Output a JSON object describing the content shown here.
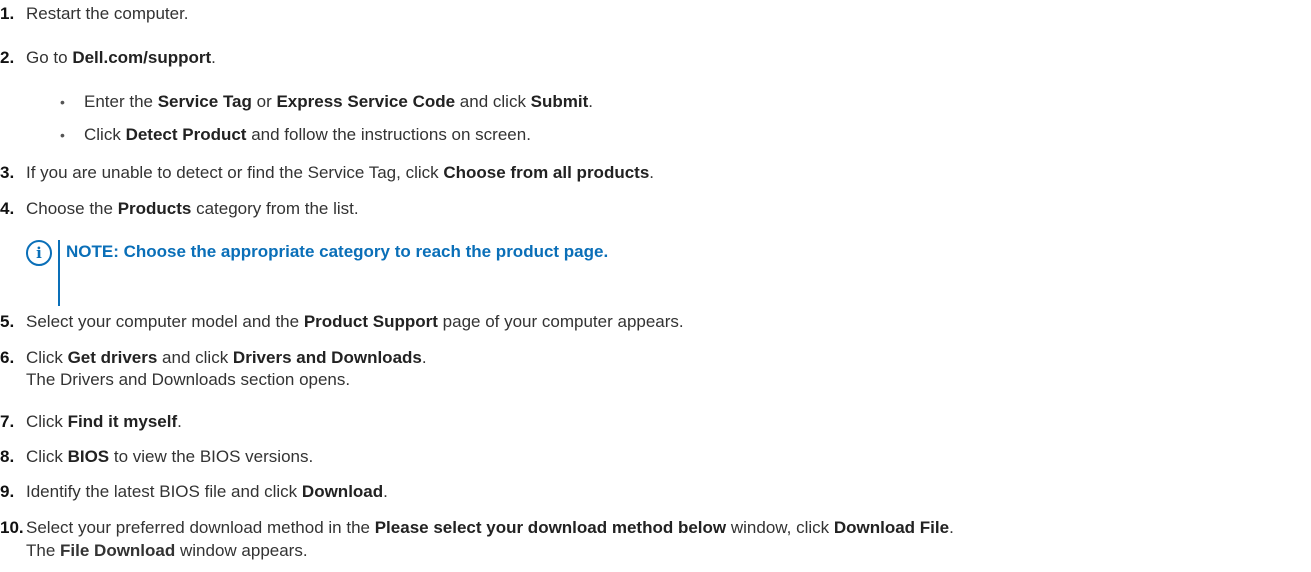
{
  "steps": [
    {
      "n": "1.",
      "pre": "Restart the computer.",
      "b1": "",
      "mid": "",
      "b2": "",
      "post": ""
    },
    {
      "n": "2.",
      "pre": "Go to ",
      "b1": "Dell.com/support",
      "mid": ".",
      "b2": "",
      "post": ""
    },
    {
      "n": "3.",
      "pre": "If you are unable to detect or find the Service Tag, click ",
      "b1": "Choose from all products",
      "mid": ".",
      "b2": "",
      "post": ""
    },
    {
      "n": "4.",
      "pre": "Choose the ",
      "b1": "Products",
      "mid": " category from the list.",
      "b2": "",
      "post": ""
    },
    {
      "n": "5.",
      "pre": "Select your computer model and the ",
      "b1": "Product Support",
      "mid": " page of your computer appears.",
      "b2": "",
      "post": ""
    },
    {
      "n": "6.",
      "pre": "Click ",
      "b1": "Get drivers",
      "mid": " and click ",
      "b2": "Drivers and Downloads",
      "post": "."
    },
    {
      "n": "7.",
      "pre": "Click ",
      "b1": "Find it myself",
      "mid": ".",
      "b2": "",
      "post": ""
    },
    {
      "n": "8.",
      "pre": "Click ",
      "b1": "BIOS",
      "mid": " to view the BIOS versions.",
      "b2": "",
      "post": ""
    },
    {
      "n": "9.",
      "pre": "Identify the latest BIOS file and click ",
      "b1": "Download",
      "mid": ".",
      "b2": "",
      "post": ""
    },
    {
      "n": "10.",
      "pre": "Select your preferred download method in the ",
      "b1": "Please select your download method below",
      "mid": " window, click ",
      "b2": "Download File",
      "post": "."
    }
  ],
  "substeps": [
    {
      "bullet": "•",
      "pre": "Enter the ",
      "b1": "Service Tag",
      "mid": " or ",
      "b2": "Express Service Code",
      "mid2": " and click ",
      "b3": "Submit",
      "post": "."
    },
    {
      "bullet": "•",
      "pre": "Click ",
      "b1": "Detect Product",
      "mid": " and follow the instructions on screen.",
      "b2": "",
      "mid2": "",
      "b3": "",
      "post": ""
    }
  ],
  "continuations": {
    "step6": "The Drivers and Downloads section opens.",
    "step10_pre": "The ",
    "step10_bold": "File Download",
    "step10_post": " window appears."
  },
  "note": {
    "icon": "info-icon",
    "glyph": "i",
    "label": "NOTE:",
    "text": " Choose the appropriate category to reach the product page."
  },
  "colors": {
    "note_accent": "#0a6fb8",
    "text": "#333333"
  }
}
